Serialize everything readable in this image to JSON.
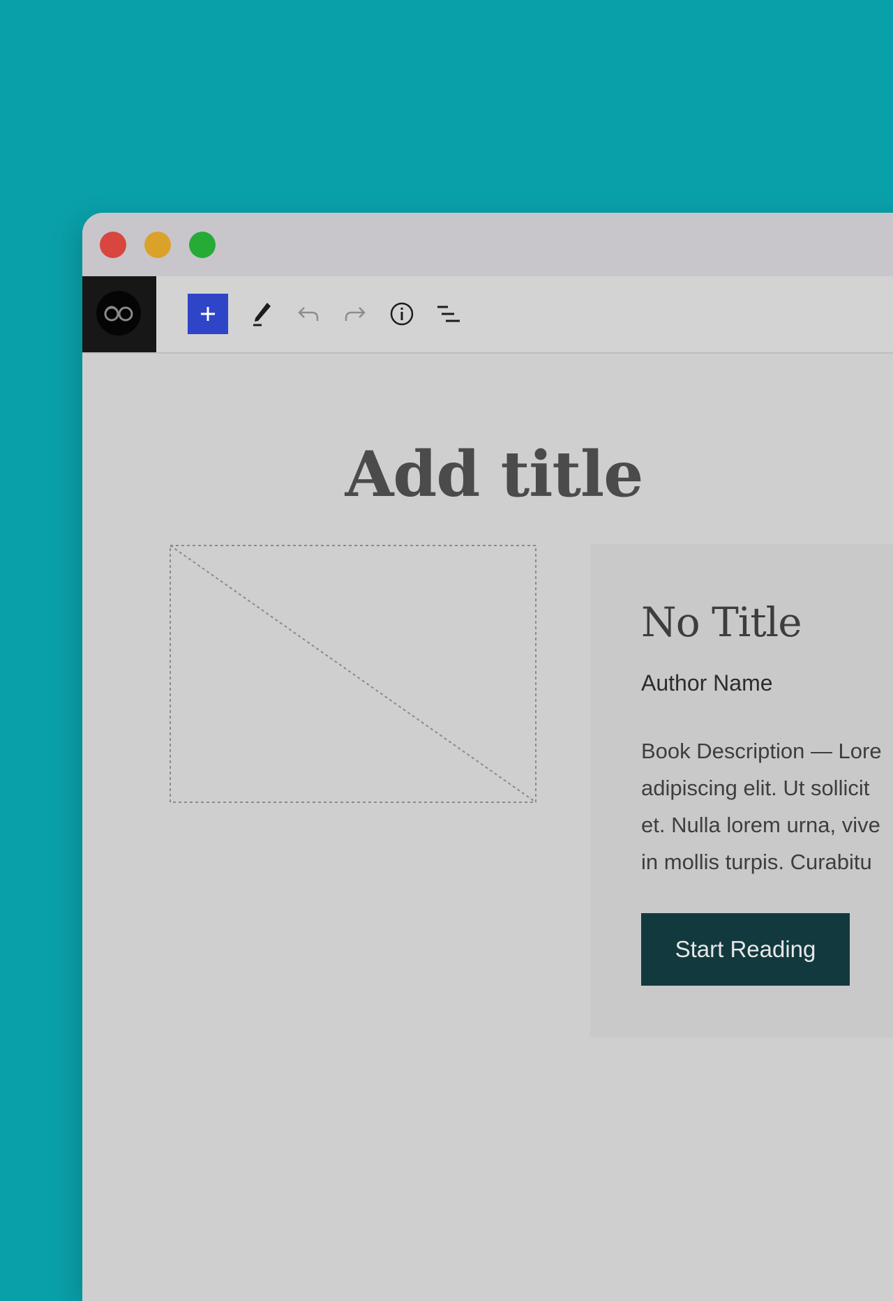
{
  "toolbar": {
    "icons": [
      "site-logo",
      "add-block-icon",
      "pen-icon",
      "undo-icon",
      "redo-icon",
      "info-icon",
      "list-view-icon"
    ],
    "accent": "#2f45c8"
  },
  "editor": {
    "title_placeholder": "Add title"
  },
  "book": {
    "title": "No Title",
    "author": "Author Name",
    "description_lines": [
      "Book Description — Lore",
      "adipiscing elit. Ut sollicit",
      "et. Nulla lorem urna, vive",
      "in mollis turpis. Curabitu"
    ],
    "button_label": "Start Reading",
    "button_color": "#123a3e"
  }
}
